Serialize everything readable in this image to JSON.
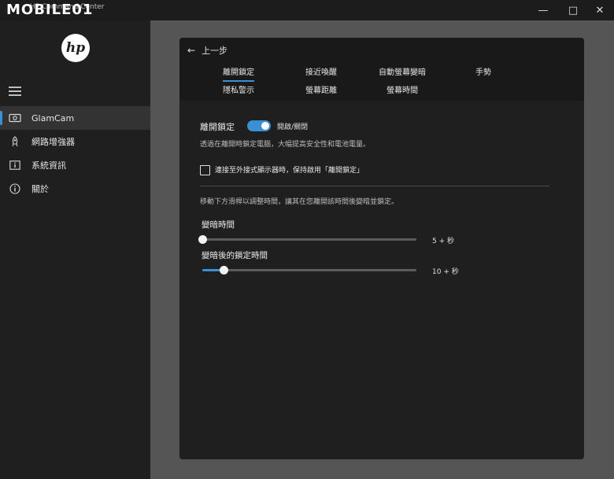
{
  "watermark": "MOBILE01",
  "window": {
    "title": "HP Command Center",
    "minimize_icon": "minimize-icon",
    "maximize_icon": "maximize-icon",
    "close_icon": "close-icon"
  },
  "sidebar": {
    "logo_text": "hp",
    "menu_icon": "hamburger-menu-icon",
    "items": [
      {
        "label": "GlamCam",
        "icon": "webcam-icon",
        "active": true
      },
      {
        "label": "網路增強器",
        "icon": "rocket-icon",
        "active": false
      },
      {
        "label": "系統資訊",
        "icon": "info-box-icon",
        "active": false
      },
      {
        "label": "關於",
        "icon": "info-circle-icon",
        "active": false
      }
    ]
  },
  "panel": {
    "back_label": "上一步",
    "tabs": [
      {
        "label": "離開鎖定",
        "active": true
      },
      {
        "label": "接近喚醒",
        "active": false
      },
      {
        "label": "自動螢幕變暗",
        "active": false
      },
      {
        "label": "手勢",
        "active": false
      },
      {
        "label": "隱私警示",
        "active": false
      },
      {
        "label": "螢幕距離",
        "active": false
      },
      {
        "label": "螢幕時間",
        "active": false
      }
    ],
    "lock_section": {
      "title": "離開鎖定",
      "toggle_state": "開啟/關閉",
      "toggle_on": true,
      "description": "透過在離開時鎖定電腦，大幅提高安全性和電池電量。",
      "external_display_label": "連接至外接式顯示器時，保持啟用「離開鎖定」",
      "external_display_checked": false
    },
    "timing_section": {
      "instruction": "移動下方滑桿以調整時間，讓其在您離開該時間後變暗並鎖定。",
      "dim_time": {
        "label": "變暗時間",
        "value_text": "5 + 秒",
        "level": 0.0
      },
      "lock_time": {
        "label": "變暗後的鎖定時間",
        "value_text": "10 + 秒",
        "level": 0.1
      }
    }
  },
  "colors": {
    "accent": "#3a8fd6",
    "panel_bg": "#1f1f1f",
    "content_bg": "#555555"
  }
}
